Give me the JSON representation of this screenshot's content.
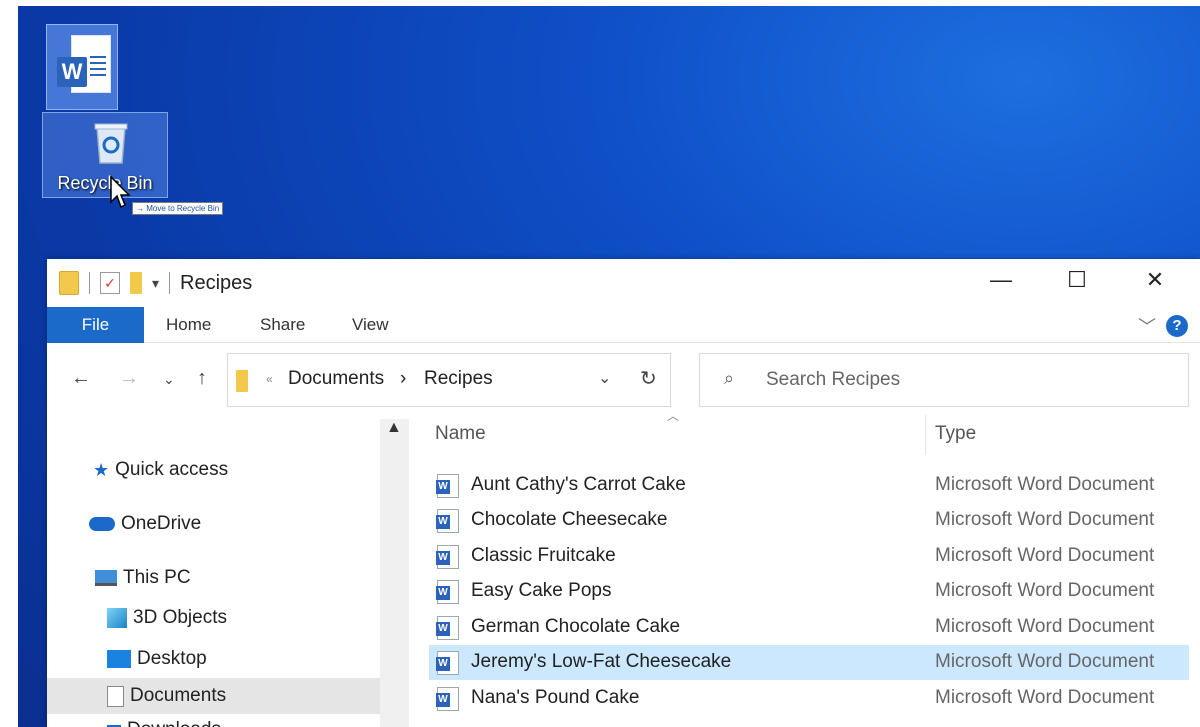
{
  "desktop": {
    "word_icon_letter": "W",
    "recycle_bin_label": "Recycle Bin",
    "drag_tooltip": "→ Move to Recycle Bin"
  },
  "explorer": {
    "title": "Recipes",
    "window_controls": {
      "minimize": "—",
      "maximize": "☐",
      "close": "✕"
    },
    "ribbon_tabs": [
      "File",
      "Home",
      "Share",
      "View"
    ],
    "help_label": "?",
    "address": {
      "overflow": "«",
      "crumbs": [
        "Documents",
        "Recipes"
      ],
      "separator": "›"
    },
    "search": {
      "placeholder": "Search Recipes"
    },
    "nav_pane": [
      {
        "label": "Quick access",
        "icon": "star-icon"
      },
      {
        "label": "OneDrive",
        "icon": "cloud-icon"
      },
      {
        "label": "This PC",
        "icon": "pc-icon"
      },
      {
        "label": "3D Objects",
        "icon": "cube-icon"
      },
      {
        "label": "Desktop",
        "icon": "desktop-folder-icon"
      },
      {
        "label": "Documents",
        "icon": "documents-icon",
        "selected": true
      },
      {
        "label": "Downloads",
        "icon": "downloads-icon"
      }
    ],
    "columns": {
      "name": "Name",
      "type": "Type"
    },
    "files": [
      {
        "name": "Aunt Cathy's Carrot Cake",
        "type": "Microsoft Word Document"
      },
      {
        "name": "Chocolate Cheesecake",
        "type": "Microsoft Word Document"
      },
      {
        "name": "Classic Fruitcake",
        "type": "Microsoft Word Document"
      },
      {
        "name": "Easy Cake Pops",
        "type": "Microsoft Word Document"
      },
      {
        "name": "German Chocolate Cake",
        "type": "Microsoft Word Document"
      },
      {
        "name": "Jeremy's Low-Fat Cheesecake",
        "type": "Microsoft Word Document",
        "selected": true
      },
      {
        "name": "Nana's Pound Cake",
        "type": "Microsoft Word Document"
      }
    ],
    "colors": {
      "accent": "#1b6ac9",
      "selection": "#cce8ff",
      "desktop": "#0f4fc7"
    }
  }
}
